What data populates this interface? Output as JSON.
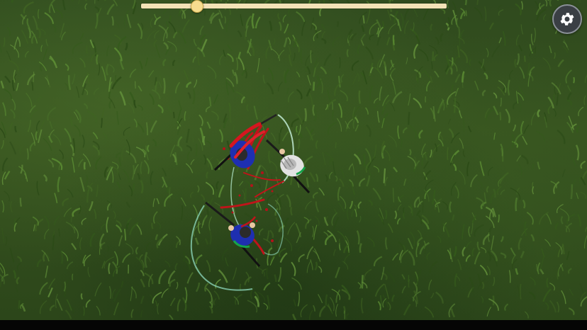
{
  "hud": {
    "slider": {
      "value": 0.18
    },
    "settings_icon": "gear-icon"
  },
  "colors": {
    "grass_dark": "#2c461a",
    "grass_light": "#4f7a2a",
    "slider_track": "#f3e2b7",
    "slider_thumb": "#f6dc8e",
    "player_team": "#1e2fb0",
    "enemy_team": "#d9d9d9",
    "blood": "#c0141a",
    "slash_trail": "#9fe3c8"
  },
  "actors": [
    {
      "name": "blue-samurai-bloodied",
      "team": "blue",
      "state": "hit"
    },
    {
      "name": "white-samurai",
      "team": "white",
      "state": "attacking"
    },
    {
      "name": "blue-samurai",
      "team": "blue",
      "state": "slashing"
    }
  ]
}
